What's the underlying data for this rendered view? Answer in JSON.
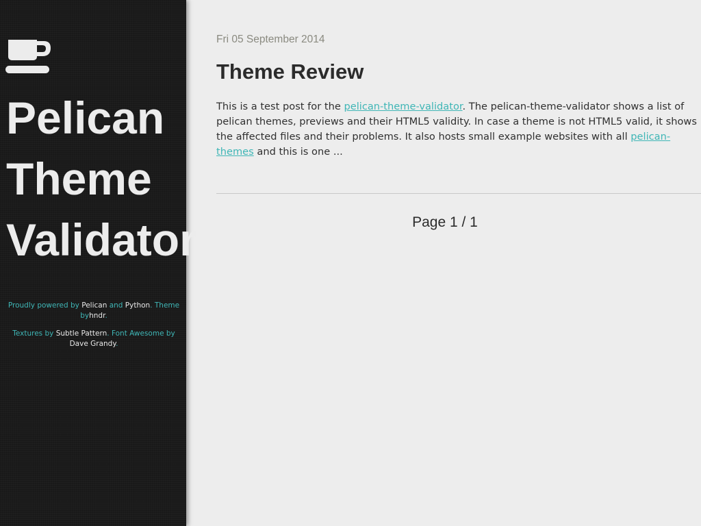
{
  "sidebar": {
    "logo_icon": "coffee-cup-icon",
    "title_lines": [
      "Pelican",
      "Theme",
      "Validator"
    ],
    "footer": {
      "line1": {
        "prefix": "Proudly powered by ",
        "pelican": "Pelican",
        "and": " and ",
        "python": "Python",
        "theme_by": ". Theme by",
        "author": "hndr",
        "end": "."
      },
      "line2": {
        "prefix": "Textures by ",
        "subtle_pattern": "Subtle Pattern",
        "fa_by": ". Font Awesome by ",
        "dave": "Dave Grandy",
        "end": "."
      }
    }
  },
  "article": {
    "date": "Fri 05 September 2014",
    "title": "Theme Review",
    "summary": {
      "part1": "This is a test post for the ",
      "link1": "pelican-theme-validator",
      "part2": ". The pelican-theme-validator shows a list of pelican themes, previews and their HTML5 validity. In case a theme is not HTML5 valid, it shows the affected files and their problems. It also hosts small example websites with all ",
      "link2": "pelican-themes",
      "part3": " and this is one ..."
    }
  },
  "pagination": {
    "text": "Page 1 / 1"
  },
  "colors": {
    "accent": "#3fb6b6",
    "sidebar_bg": "#1b1b1b",
    "content_bg": "#ededed"
  }
}
